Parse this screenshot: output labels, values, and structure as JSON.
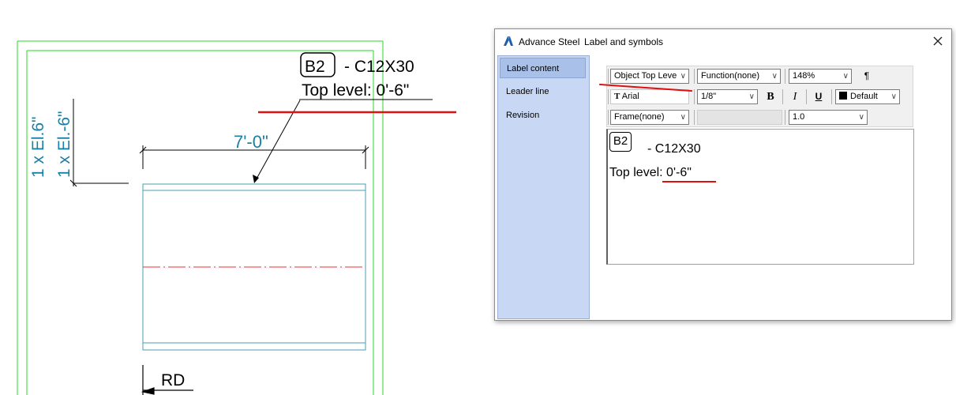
{
  "drawing": {
    "label_badge": "B2",
    "label_profile": "- C12X30",
    "label_top_level": "Top level: 0'-6\"",
    "dimension": "7'-0\"",
    "elevation_1": "1 x El.6\"",
    "elevation_2": "1 x El.-6\"",
    "section_mark": "RD",
    "colors": {
      "frame_green": "#26d926",
      "beam_cyan": "#4a9fb0",
      "text_teal": "#1a7fa6",
      "centerline_red": "#e83030",
      "highlight_red": "#e01010"
    }
  },
  "dialog": {
    "app_name": "Advance Steel",
    "title": "Label and symbols",
    "app_icon": "autodesk-a-icon",
    "close_icon": "close-icon",
    "sidebar": {
      "items": [
        {
          "label": "Label content",
          "active": true
        },
        {
          "label": "Leader line",
          "active": false
        },
        {
          "label": "Revision",
          "active": false
        }
      ]
    },
    "toolbar": {
      "content_select": "Object Top Leve",
      "function_select": "Function(none)",
      "zoom_select": "148%",
      "paragraph_icon": "paragraph-icon",
      "font_icon": "truetype-font-icon",
      "font_select": "Arial",
      "size_select": "1/8\"",
      "bold_label": "B",
      "italic_label": "I",
      "underline_label": "U",
      "color_select": "Default",
      "color_swatch": "#000000",
      "frame_select": "Frame(none)",
      "line_spacing_select": "1.0"
    },
    "preview": {
      "badge": "B2",
      "profile": "- C12X30",
      "top_level": "Top level: 0'-6\""
    }
  }
}
